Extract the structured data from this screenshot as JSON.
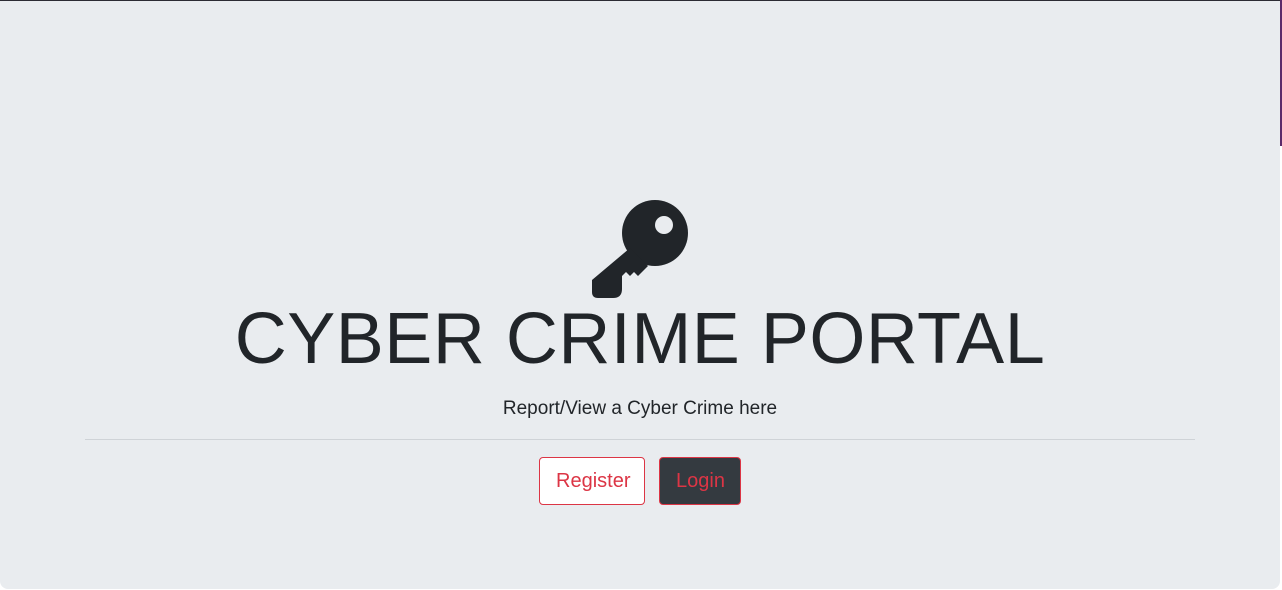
{
  "header": {
    "icon": "key-icon",
    "title": "CYBER CRIME PORTAL",
    "subtitle": "Report/View a Cyber Crime here"
  },
  "actions": {
    "register_label": "Register",
    "login_label": "Login"
  },
  "colors": {
    "background": "#e9ecef",
    "text": "#212529",
    "accent": "#dc3545",
    "dark_button": "#343a40"
  }
}
